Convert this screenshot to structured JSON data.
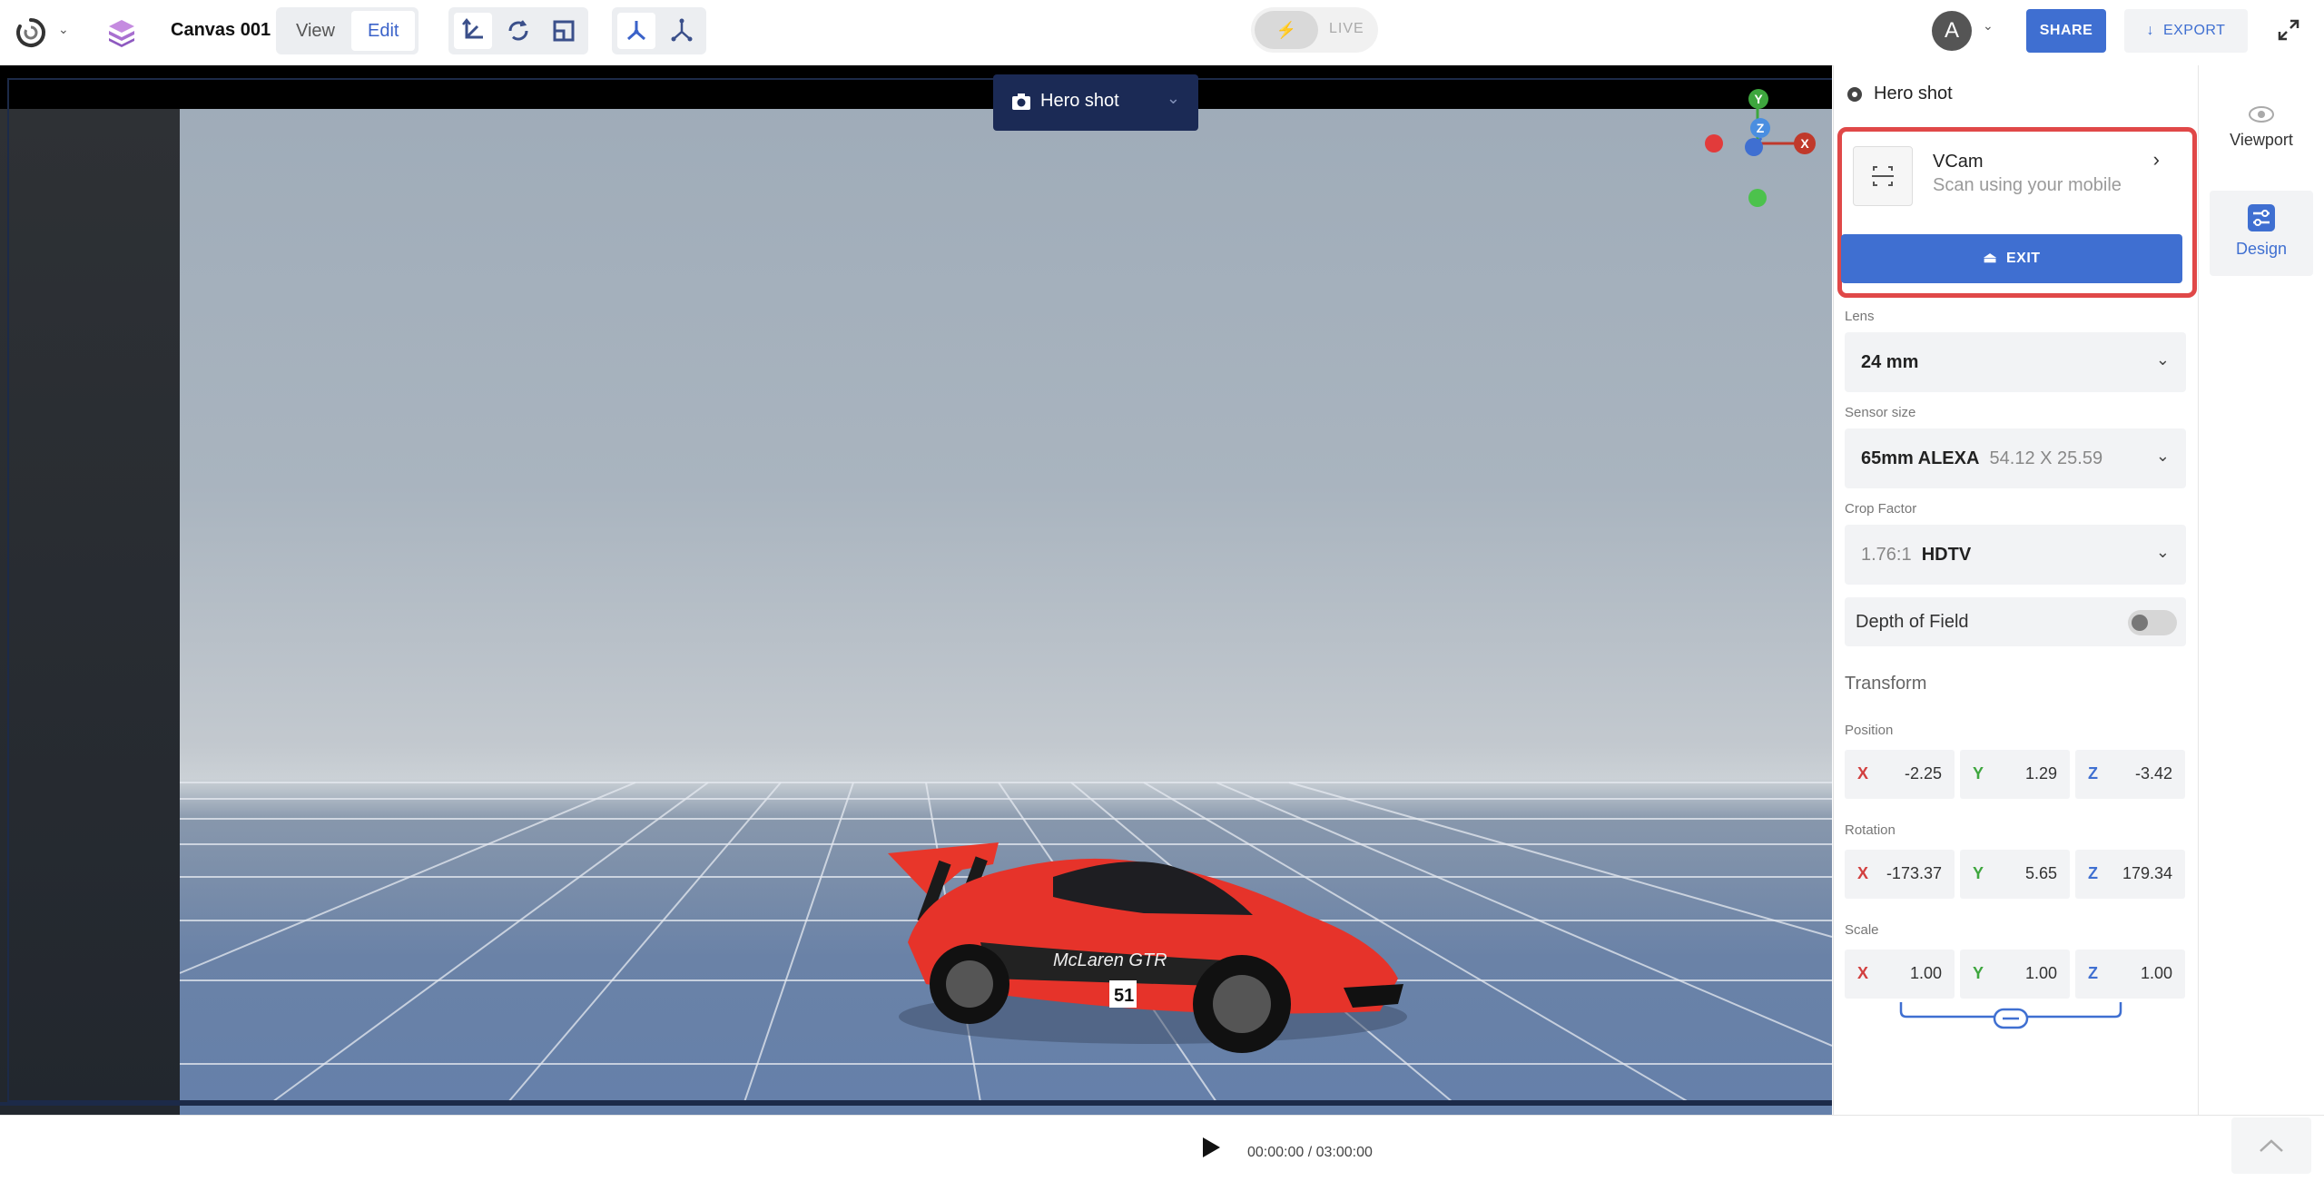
{
  "topbar": {
    "canvas_title": "Canvas 001",
    "mode_view": "View",
    "mode_edit": "Edit",
    "live_label": "LIVE",
    "avatar_initial": "A",
    "share_label": "SHARE",
    "export_label": "EXPORT"
  },
  "viewport": {
    "camera_name": "Hero shot",
    "gizmo": {
      "y": "Y",
      "z": "Z",
      "x": "X"
    }
  },
  "panel": {
    "title": "Hero shot",
    "vcam": {
      "name": "VCam",
      "subtitle": "Scan using your mobile",
      "exit_label": "EXIT"
    },
    "lens": {
      "label": "Lens",
      "value": "24 mm"
    },
    "sensor": {
      "label": "Sensor size",
      "name": "65mm ALEXA",
      "dims": "54.12 X 25.59"
    },
    "crop": {
      "label": "Crop Factor",
      "ratio": "1.76:1",
      "name": "HDTV"
    },
    "dof": {
      "label": "Depth of Field",
      "enabled": false
    },
    "transform": {
      "title": "Transform",
      "position": {
        "label": "Position",
        "x": "-2.25",
        "y": "1.29",
        "z": "-3.42"
      },
      "rotation": {
        "label": "Rotation",
        "x": "-173.37",
        "y": "5.65",
        "z": "179.34"
      },
      "scale": {
        "label": "Scale",
        "x": "1.00",
        "y": "1.00",
        "z": "1.00"
      },
      "axis_labels": {
        "x": "X",
        "y": "Y",
        "z": "Z"
      }
    }
  },
  "rail": {
    "viewport_label": "Viewport",
    "design_label": "Design"
  },
  "timeline": {
    "timecode": "00:00:00 / 03:00:00"
  },
  "colors": {
    "accent": "#3f6fd1",
    "highlight": "#e04848",
    "axis_x": "#d23f3f",
    "axis_y": "#3ea63e",
    "axis_z": "#3f6fd1"
  }
}
